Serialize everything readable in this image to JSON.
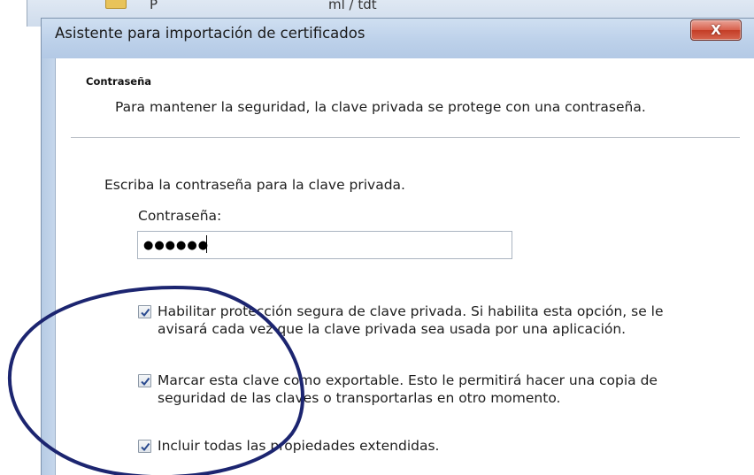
{
  "background_window": {
    "partial_text_a": "P",
    "partial_text_b": "ml / tdt"
  },
  "dialog": {
    "title": "Asistente para importación de certificados",
    "close_label": "X"
  },
  "section": {
    "title": "Contraseña",
    "description": "Para mantener la seguridad, la clave privada se protege con una contraseña."
  },
  "password": {
    "prompt": "Escriba la contraseña para la clave privada.",
    "label": "Contraseña:",
    "value": "●●●●●●"
  },
  "options": [
    {
      "checked": true,
      "line1": "Habilitar protección segura de clave privada. Si habilita esta opción, se le",
      "line2": "avisará cada vez que la clave privada sea usada por una aplicación."
    },
    {
      "checked": true,
      "line1": "Marcar esta clave como exportable. Esto le permitirá hacer una copia de",
      "line2": "seguridad de las claves o transportarlas en otro momento."
    },
    {
      "checked": true,
      "line1": "Incluir todas las propiedades extendidas.",
      "line2": ""
    }
  ],
  "colors": {
    "annotation_ellipse": "#1c2570",
    "checkmark": "#2a4a8f",
    "close_button": "#c94a35"
  }
}
